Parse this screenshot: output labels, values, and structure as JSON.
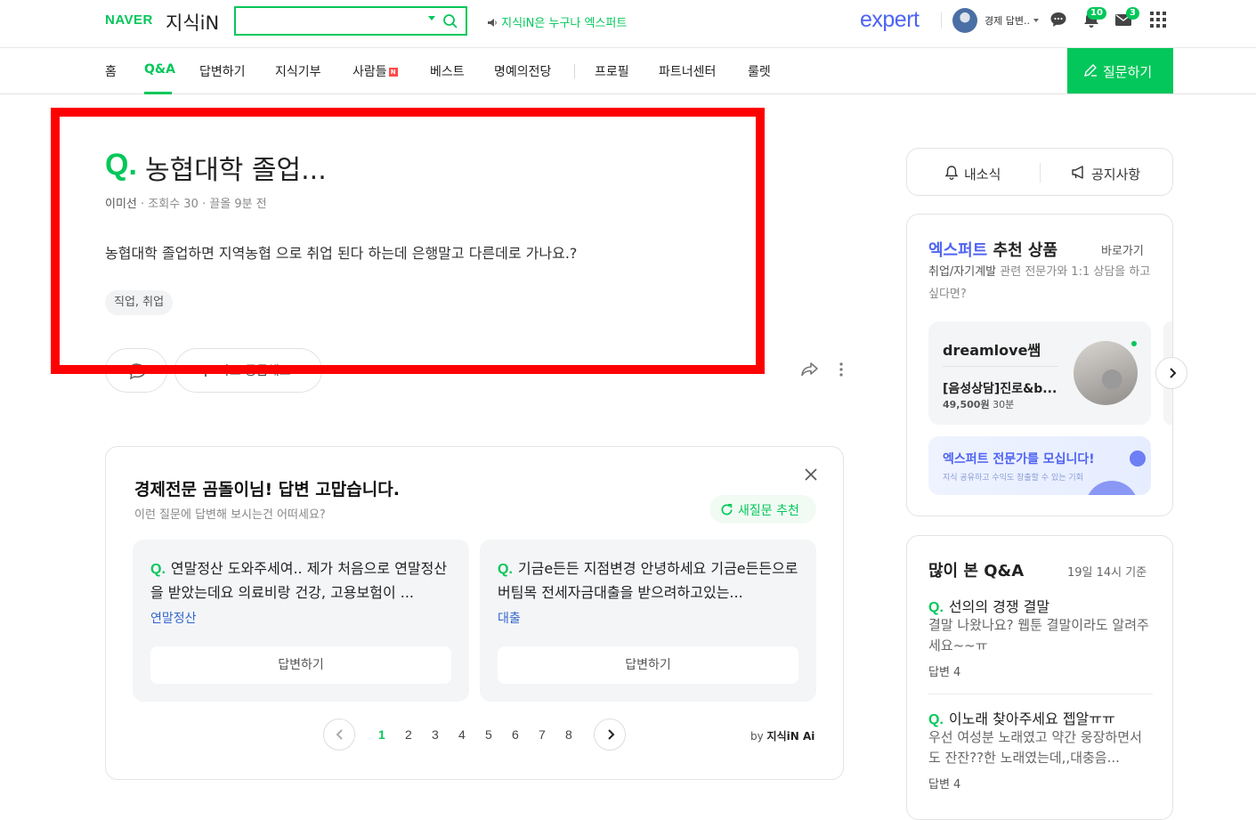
{
  "header": {
    "logo_naver": "NAVER",
    "logo_kin": "지식iN",
    "search": {
      "value": "",
      "placeholder": ""
    },
    "promo": "지식iN은 누구나 엑스퍼트",
    "expert_logo": "expert",
    "user_name": "경제 답변..",
    "notifications_count": "10",
    "mail_count": "3"
  },
  "nav": {
    "items": [
      "홈",
      "Q&A",
      "답변하기",
      "지식기부",
      "사람들",
      "베스트",
      "명예의전당",
      "프로필",
      "파트너센터",
      "룰렛"
    ],
    "active": "Q&A",
    "new_badge": "N",
    "ask_button": "질문하기"
  },
  "question": {
    "q_mark": "Q.",
    "title": "농협대학 졸업...",
    "author": "이미선",
    "views": "조회수 30",
    "time": "끌올 9분 전",
    "body": "농협대학 졸업하면 지역농협 으로 취업 된다 하는데 은행말고 다른데로 가나요.?",
    "tag": "직업, 취업",
    "curious_label": "나도 궁금해요"
  },
  "suggestions": {
    "title": "경제전문 곰돌이님! 답변 고맙습니다.",
    "subtitle": "이런 질문에 답변해 보시는건 어떠세요?",
    "refresh_label": "새질문 추천",
    "cards": [
      {
        "question": "연말정산 도와주세여.. 제가 처음으로 연말정산을 받았는데요 의료비랑 건강, 고용보험이 ...",
        "tag": "연말정산",
        "answer_label": "답변하기"
      },
      {
        "question": "기금e든든 지점변경 안녕하세요 기금e든든으로 버팀목 전세자금대출을 받으려하고있는...",
        "tag": "대출",
        "answer_label": "답변하기"
      }
    ],
    "pages": [
      "1",
      "2",
      "3",
      "4",
      "5",
      "6",
      "7",
      "8"
    ],
    "active_page": "1",
    "by_label": "by",
    "by_brand": "지식iN Ai"
  },
  "sidebar": {
    "news_label": "내소식",
    "notice_label": "공지사항",
    "expert_box": {
      "title_blue": "엑스퍼트",
      "title_rest": "추천 상품",
      "go_label": "바로가기",
      "desc_dark": "취업/자기계발",
      "desc_rest": "관련 전문가와 1:1 상담을 하고 싶다면?",
      "expert_name": "dreamlove쌤",
      "product": "[음성상담]진로&b...",
      "price": "49,500원",
      "duration": "30분",
      "recruit_title": "엑스퍼트 전문가를 모십니다!",
      "recruit_sub": "지식 공유하고 수익도 창출할 수 있는 기회"
    },
    "popular": {
      "title": "많이 본 Q&A",
      "time": "19일 14시 기준",
      "items": [
        {
          "q": "선의의 경쟁 결말",
          "body": "결말 나왔나요? 웹툰 결말이라도 알려주세요~~ㅠ",
          "count": "답변 4"
        },
        {
          "q": "이노래 찾아주세요 젭알ㅠㅠ",
          "body": "우선 여성분 노래였고 약간 웅장하면서도 잔잔??한 노래였는데,,대충음...",
          "count": "답변 4"
        }
      ]
    }
  }
}
